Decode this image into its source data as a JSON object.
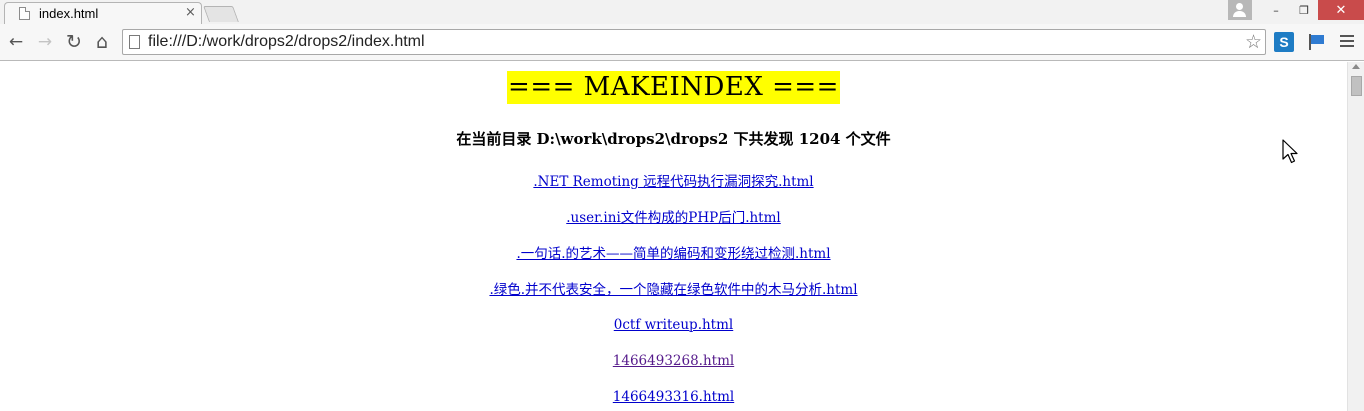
{
  "browser": {
    "tab": {
      "title": "index.html",
      "close_glyph": "×"
    },
    "window_controls": {
      "minimize": "–",
      "restore": "❐",
      "close": "✕"
    },
    "nav": {
      "back": "←",
      "forward": "→",
      "reload": "↻",
      "home": "⌂"
    },
    "omnibox": {
      "url": "file:///D:/work/drops2/drops2/index.html",
      "bookmark_star": "☆"
    },
    "extensions": {
      "s_label": "S"
    }
  },
  "page": {
    "title": "=== MAKEINDEX ===",
    "summary": "在当前目录 D:\\work\\drops2\\drops2 下共发现 1204 个文件",
    "files": [
      {
        "label": ".NET Remoting 远程代码执行漏洞探究.html",
        "visited": false
      },
      {
        "label": ".user.ini文件构成的PHP后门.html",
        "visited": false
      },
      {
        "label": ".一句话.的艺术——简单的编码和变形绕过检测.html",
        "visited": false
      },
      {
        "label": ".绿色.并不代表安全，一个隐藏在绿色软件中的木马分析.html",
        "visited": false
      },
      {
        "label": "0ctf writeup.html",
        "visited": false
      },
      {
        "label": "1466493268.html",
        "visited": true
      },
      {
        "label": "1466493316.html",
        "visited": false
      }
    ]
  },
  "colors": {
    "title_highlight": "#ffff00",
    "link": "#0000cc",
    "visited_link": "#551a8b",
    "close_button": "#c94b4b"
  },
  "icons": [
    "page-icon",
    "close-icon",
    "back-icon",
    "forward-icon",
    "reload-icon",
    "home-icon",
    "star-icon",
    "sogou-s-icon",
    "flag-icon",
    "menu-icon",
    "profile-icon",
    "cursor-icon"
  ]
}
